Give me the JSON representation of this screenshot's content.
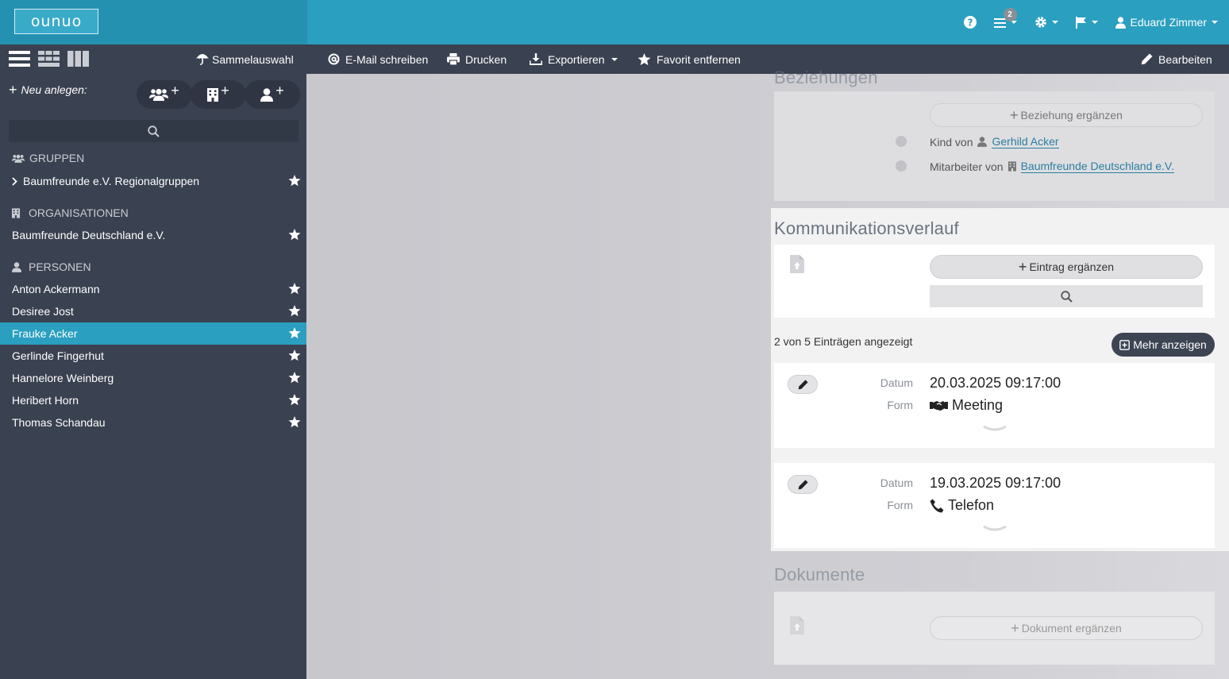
{
  "header": {
    "logo": "ounuo",
    "notifications_count": "2",
    "user_name": "Eduard Zimmer"
  },
  "toolbar": {
    "sammelauswahl": "Sammelauswahl",
    "email": "E-Mail schreiben",
    "drucken": "Drucken",
    "exportieren": "Exportieren",
    "favorit": "Favorit entfernen",
    "bearbeiten": "Bearbeiten"
  },
  "sidebar": {
    "neu_anlegen": "Neu anlegen:",
    "gruppen": {
      "heading": "GRUPPEN",
      "items": [
        {
          "label": "Baumfreunde e.V. Regionalgruppen"
        }
      ]
    },
    "organisationen": {
      "heading": "ORGANISATIONEN",
      "items": [
        {
          "label": "Baumfreunde Deutschland e.V."
        }
      ]
    },
    "personen": {
      "heading": "PERSONEN",
      "items": [
        {
          "label": "Anton Ackermann"
        },
        {
          "label": "Desiree Jost"
        },
        {
          "label": "Frauke Acker"
        },
        {
          "label": "Gerlinde Fingerhut"
        },
        {
          "label": "Hannelore Weinberg"
        },
        {
          "label": "Heribert Horn"
        },
        {
          "label": "Thomas Schandau"
        }
      ],
      "active_index": 2
    }
  },
  "beziehungen": {
    "title": "Beziehungen",
    "add_label": "Beziehung ergänzen",
    "relations": [
      {
        "prefix": "Kind von",
        "name": "Gerhild Acker"
      },
      {
        "prefix": "Mitarbeiter von",
        "name": "Baumfreunde Deutschland e.V."
      }
    ]
  },
  "kommunikation": {
    "title": "Kommunikationsverlauf",
    "add_label": "Eintrag ergänzen",
    "count_text": "2 von 5 Einträgen angezeigt",
    "mehr_label": "Mehr anzeigen",
    "date_label": "Datum",
    "form_label": "Form",
    "entries": [
      {
        "datum": "20.03.2025 09:17:00",
        "form": "Meeting"
      },
      {
        "datum": "19.03.2025 09:17:00",
        "form": "Telefon"
      }
    ]
  },
  "dokumente": {
    "title": "Dokumente",
    "add_label": "Dokument ergänzen"
  },
  "colors": {
    "accent": "#2a9fc0",
    "sidebar": "#3a4150",
    "link": "#2a7fa0"
  }
}
